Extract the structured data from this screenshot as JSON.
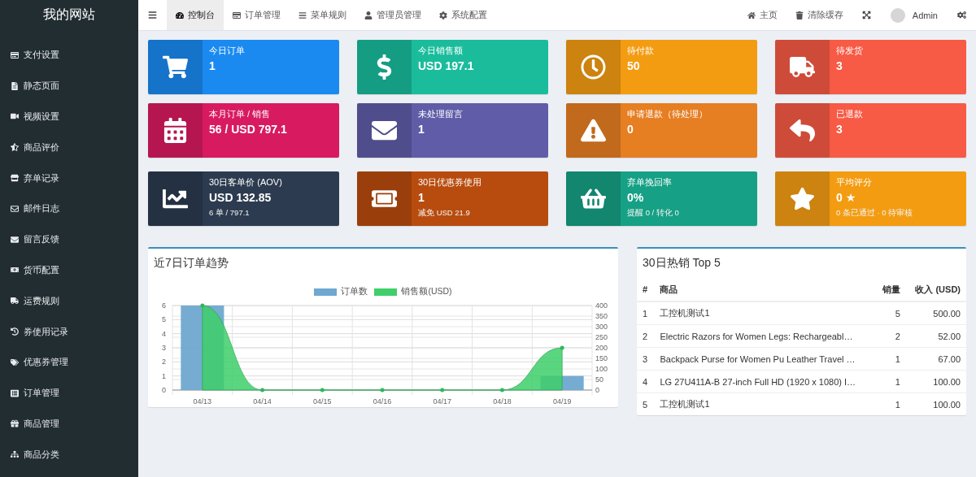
{
  "sidebar": {
    "title": "我的网站",
    "items": [
      {
        "label": "支付设置"
      },
      {
        "label": "静态页面"
      },
      {
        "label": "视频设置"
      },
      {
        "label": "商品评价"
      },
      {
        "label": "弃单记录"
      },
      {
        "label": "邮件日志"
      },
      {
        "label": "留言反馈"
      },
      {
        "label": "货币配置"
      },
      {
        "label": "运费规则"
      },
      {
        "label": "券使用记录"
      },
      {
        "label": "优惠券管理"
      },
      {
        "label": "订单管理"
      },
      {
        "label": "商品管理"
      },
      {
        "label": "商品分类"
      }
    ]
  },
  "header": {
    "tabs": [
      {
        "label": "控制台",
        "selected": true
      },
      {
        "label": "订单管理",
        "selected": false
      },
      {
        "label": "菜单规则",
        "selected": false
      },
      {
        "label": "管理员管理",
        "selected": false
      },
      {
        "label": "系统配置",
        "selected": false
      }
    ],
    "links": [
      {
        "label": "主页"
      },
      {
        "label": "清除缓存"
      }
    ],
    "user": "Admin"
  },
  "stats": [
    {
      "title": "今日订单",
      "value": "1",
      "color": "#1a8af0"
    },
    {
      "title": "今日销售额",
      "value": "USD 197.1",
      "color": "#1abc9c"
    },
    {
      "title": "待付款",
      "value": "50",
      "color": "#f39c12"
    },
    {
      "title": "待发货",
      "value": "3",
      "color": "#f75a45"
    },
    {
      "title": "本月订单 / 销售",
      "value": "56 / USD 797.1",
      "color": "#d81b60"
    },
    {
      "title": "未处理留言",
      "value": "1",
      "color": "#605ca8"
    },
    {
      "title": "申请退款（待处理）",
      "value": "0",
      "color": "#e67e22"
    },
    {
      "title": "已退款",
      "value": "3",
      "color": "#f75a45"
    },
    {
      "title": "30日客单价 (AOV)",
      "value": "USD 132.85",
      "sub": "6 单 / 797.1",
      "color": "#2c3b4f"
    },
    {
      "title": "30日优惠券使用",
      "value": "1",
      "sub": "减免 USD 21.9",
      "color": "#b84c0e"
    },
    {
      "title": "弃单挽回率",
      "value": "0%",
      "sub": "提醒 0 / 转化 0",
      "color": "#16a085"
    },
    {
      "title": "平均评分",
      "value": "0 ★",
      "sub": "0 条已通过 · 0 待审核",
      "color": "#f39c12"
    }
  ],
  "trend": {
    "title": "近7日订单趋势",
    "chart_data": {
      "type": "bar",
      "categories": [
        "04/13",
        "04/14",
        "04/15",
        "04/16",
        "04/17",
        "04/18",
        "04/19"
      ],
      "series": [
        {
          "name": "订单数",
          "color": "#6fa8d0",
          "values": [
            6,
            0,
            0,
            0,
            0,
            0,
            1
          ]
        },
        {
          "name": "销售额(USD)",
          "type": "area",
          "axis": "y2",
          "color": "#3ecf6a",
          "values": [
            400,
            0,
            0,
            0,
            0,
            0,
            200
          ]
        }
      ],
      "grid": true,
      "legend": "top",
      "ylim": [
        0,
        6
      ],
      "yticks": [
        0,
        1,
        2,
        3,
        4,
        5,
        6
      ],
      "y2lim": [
        0,
        400
      ],
      "y2ticks": [
        0,
        50,
        100,
        150,
        200,
        250,
        300,
        350,
        400
      ]
    }
  },
  "top": {
    "title": "30日热销 Top 5",
    "columns": [
      "#",
      "商品",
      "销量",
      "收入 (USD)"
    ],
    "rows": [
      [
        "1",
        "工控机测试1",
        "5",
        "500.00"
      ],
      [
        "2",
        "Electric Razors for Women Legs: Rechargeabl…",
        "2",
        "52.00"
      ],
      [
        "3",
        "Backpack Purse for Women Pu Leather Travel …",
        "1",
        "67.00"
      ],
      [
        "4",
        "LG 27U411A-B 27-inch Full HD (1920 x 1080) I…",
        "1",
        "100.00"
      ],
      [
        "5",
        "工控机测试1",
        "1",
        "100.00"
      ]
    ]
  }
}
